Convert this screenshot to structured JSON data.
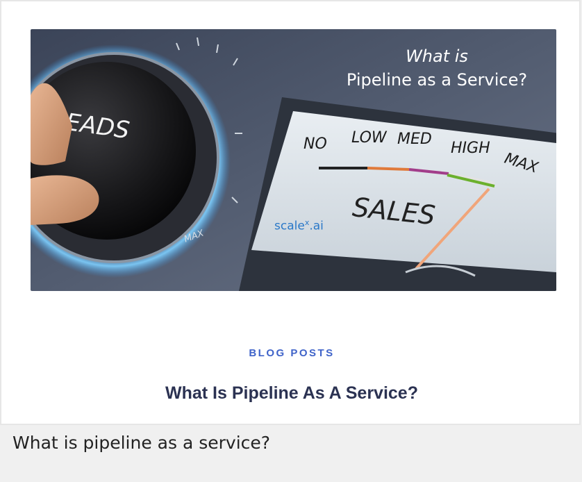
{
  "hero": {
    "title_line1": "What is",
    "title_line2": "Pipeline as a Service?",
    "knob_label": "LEADS",
    "knob_max": "MAX",
    "gauge_labels": [
      "NO",
      "LOW",
      "MED",
      "HIGH",
      "MAX"
    ],
    "gauge_title": "SALES",
    "brand_main": "scale",
    "brand_sup": "x",
    "brand_tld": ".ai"
  },
  "post": {
    "category": "BLOG POSTS",
    "title": "What Is Pipeline As A Service?"
  },
  "caption": "What is pipeline as a service?"
}
